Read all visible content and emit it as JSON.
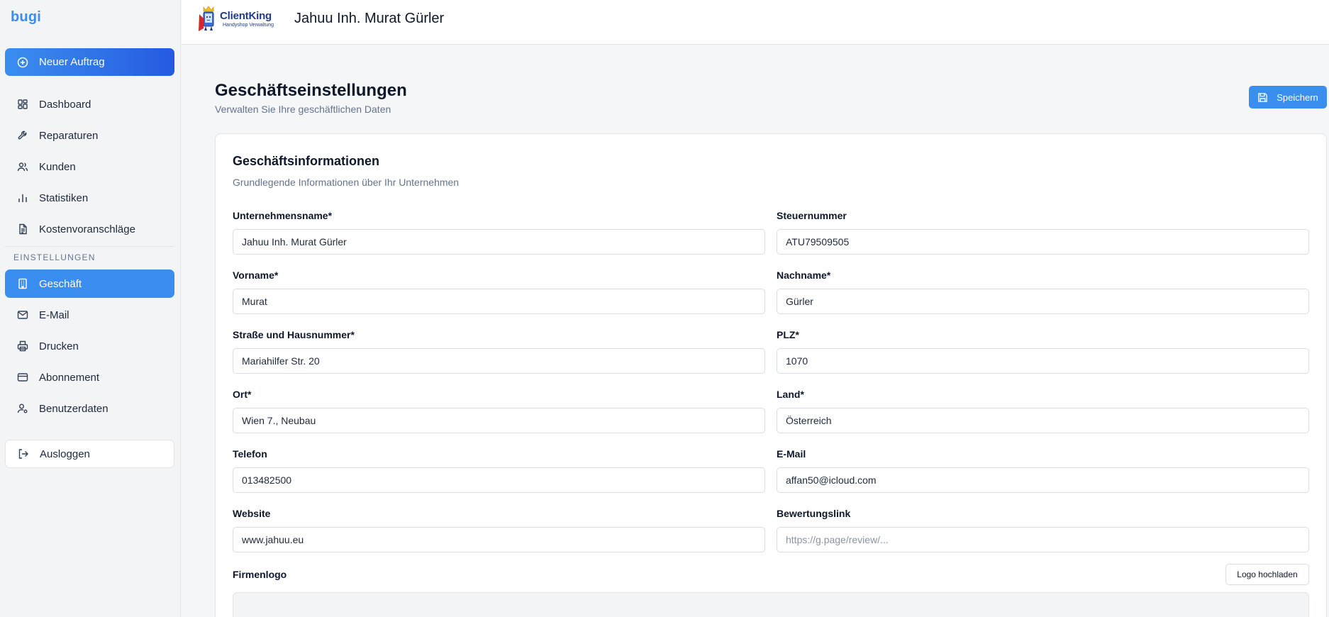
{
  "sidebar": {
    "brand": "bugi",
    "new_order": "Neuer Auftrag",
    "items": [
      {
        "label": "Dashboard",
        "icon": "dashboard-icon"
      },
      {
        "label": "Reparaturen",
        "icon": "wrench-icon"
      },
      {
        "label": "Kunden",
        "icon": "users-icon"
      },
      {
        "label": "Statistiken",
        "icon": "bar-chart-icon"
      },
      {
        "label": "Kostenvoranschläge",
        "icon": "document-icon"
      }
    ],
    "section_label": "EINSTELLUNGEN",
    "settings_items": [
      {
        "label": "Geschäft",
        "icon": "building-icon",
        "active": true
      },
      {
        "label": "E-Mail",
        "icon": "mail-icon"
      },
      {
        "label": "Drucken",
        "icon": "printer-icon"
      },
      {
        "label": "Abonnement",
        "icon": "credit-card-icon"
      },
      {
        "label": "Benutzerdaten",
        "icon": "user-cog-icon"
      }
    ],
    "logout": "Ausloggen"
  },
  "header": {
    "logo_name": "ClientKing",
    "logo_sub": "Handyshop Verwaltung",
    "title": "Jahuu Inh. Murat Gürler"
  },
  "page": {
    "title": "Geschäftseinstellungen",
    "subtitle": "Verwalten Sie Ihre geschäftlichen Daten",
    "save_label": "Speichern"
  },
  "card": {
    "title": "Geschäftsinformationen",
    "subtitle": "Grundlegende Informationen über Ihr Unternehmen",
    "fields": {
      "company_name": {
        "label": "Unternehmensname*",
        "value": "Jahuu Inh. Murat Gürler"
      },
      "tax_number": {
        "label": "Steuernummer",
        "value": "ATU79509505"
      },
      "first_name": {
        "label": "Vorname*",
        "value": "Murat"
      },
      "last_name": {
        "label": "Nachname*",
        "value": "Gürler"
      },
      "street": {
        "label": "Straße und Hausnummer*",
        "value": "Mariahilfer Str. 20"
      },
      "zip": {
        "label": "PLZ*",
        "value": "1070"
      },
      "city": {
        "label": "Ort*",
        "value": "Wien 7., Neubau"
      },
      "country": {
        "label": "Land*",
        "value": "Österreich"
      },
      "phone": {
        "label": "Telefon",
        "value": "013482500"
      },
      "email": {
        "label": "E-Mail",
        "value": "affan50@icloud.com"
      },
      "website": {
        "label": "Website",
        "value": "www.jahuu.eu"
      },
      "review_link": {
        "label": "Bewertungslink",
        "value": "",
        "placeholder": "https://g.page/review/..."
      }
    },
    "logo_label": "Firmenlogo",
    "upload_label": "Logo hochladen"
  },
  "colors": {
    "accent": "#3a8ef0",
    "brand": "#3b8eea",
    "logo_blue": "#1f3c88"
  }
}
